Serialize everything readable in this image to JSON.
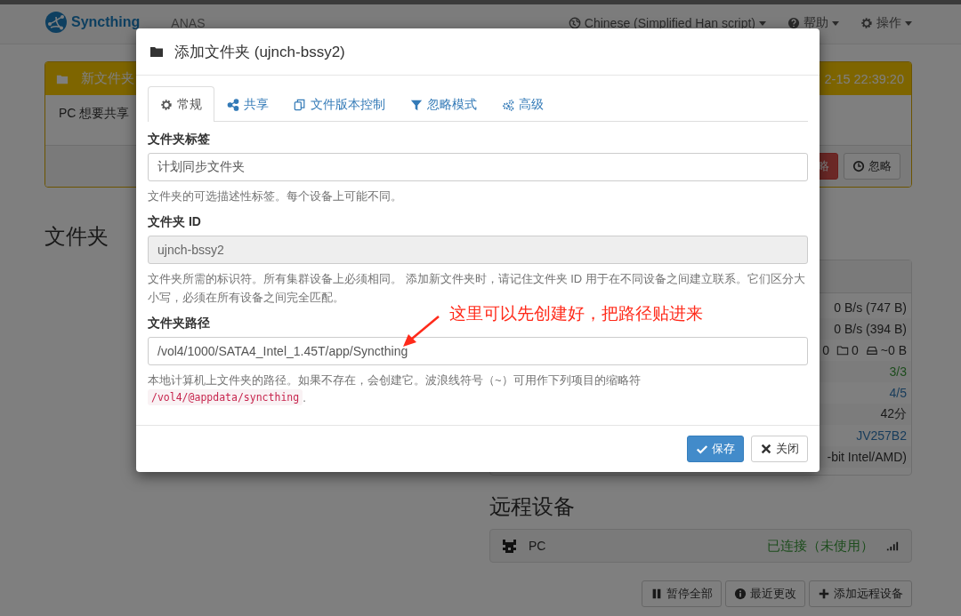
{
  "navbar": {
    "brand": "Syncthing",
    "device_name": "ANAS",
    "menus": [
      {
        "kind": "language",
        "label": "Chinese (Simplified Han script)"
      },
      {
        "kind": "help",
        "label": "帮助"
      },
      {
        "kind": "actions",
        "label": "操作"
      }
    ]
  },
  "banner": {
    "title": "新文件夹",
    "time": "2-15 22:39:20",
    "message": "PC 想要共享",
    "buttons": [
      {
        "kind": "danger",
        "label": "略"
      },
      {
        "kind": "default",
        "label": "忽略"
      }
    ]
  },
  "folders_heading": "文件夹",
  "this_device": {
    "rows": [
      {
        "kind": "plain",
        "value": "0 B/s (747 B)"
      },
      {
        "kind": "plain",
        "value": "0 B/s (394 B)"
      },
      {
        "kind": "counts",
        "files": "0",
        "folders": "0",
        "size": "~0 B"
      },
      {
        "kind": "success",
        "value": "3/3"
      },
      {
        "kind": "link",
        "value": "4/5"
      },
      {
        "kind": "plain",
        "value": "42分"
      },
      {
        "kind": "link",
        "value": "JV257B2"
      },
      {
        "kind": "plain",
        "value": "-bit Intel/AMD)"
      }
    ]
  },
  "remote_devices": {
    "heading": "远程设备",
    "devices": [
      {
        "name": "PC",
        "status": "已连接（未使用）"
      }
    ],
    "buttons": [
      {
        "kind": "pause",
        "label": "暂停全部"
      },
      {
        "kind": "info",
        "label": "最近更改"
      },
      {
        "kind": "add",
        "label": "添加远程设备"
      }
    ]
  },
  "dialog": {
    "title": "添加文件夹 (ujnch-bssy2)",
    "tabs": [
      {
        "kind": "general",
        "label": "常规",
        "selected": true
      },
      {
        "kind": "sharing",
        "label": "共享",
        "selected": false
      },
      {
        "kind": "versioning",
        "label": "文件版本控制",
        "selected": false
      },
      {
        "kind": "ignore",
        "label": "忽略模式",
        "selected": false
      },
      {
        "kind": "advanced",
        "label": "高级",
        "selected": false
      }
    ],
    "fields": [
      {
        "label": "文件夹标签",
        "value": "计划同步文件夹",
        "disabled": false,
        "help": "文件夹的可选描述性标签。每个设备上可能不同。"
      },
      {
        "label": "文件夹 ID",
        "value": "ujnch-bssy2",
        "disabled": true,
        "help": "文件夹所需的标识符。所有集群设备上必须相同。 添加新文件夹时，请记住文件夹 ID 用于在不同设备之间建立联系。它们区分大小写，必须在所有设备之间完全匹配。"
      },
      {
        "label": "文件夹路径",
        "value": "/vol4/1000/SATA4_Intel_1.45T/app/Syncthing",
        "disabled": false,
        "help": "本地计算机上文件夹的路径。如果不存在，会创建它。波浪线符号（~）可用作下列项目的缩略符",
        "help_code": "/vol4/@appdata/syncthing",
        "help_suffix": "."
      }
    ],
    "buttons": [
      {
        "kind": "save",
        "label": "保存"
      },
      {
        "kind": "close",
        "label": "关闭"
      }
    ]
  },
  "annotation": {
    "text": "这里可以先创建好，把路径贴进来"
  }
}
